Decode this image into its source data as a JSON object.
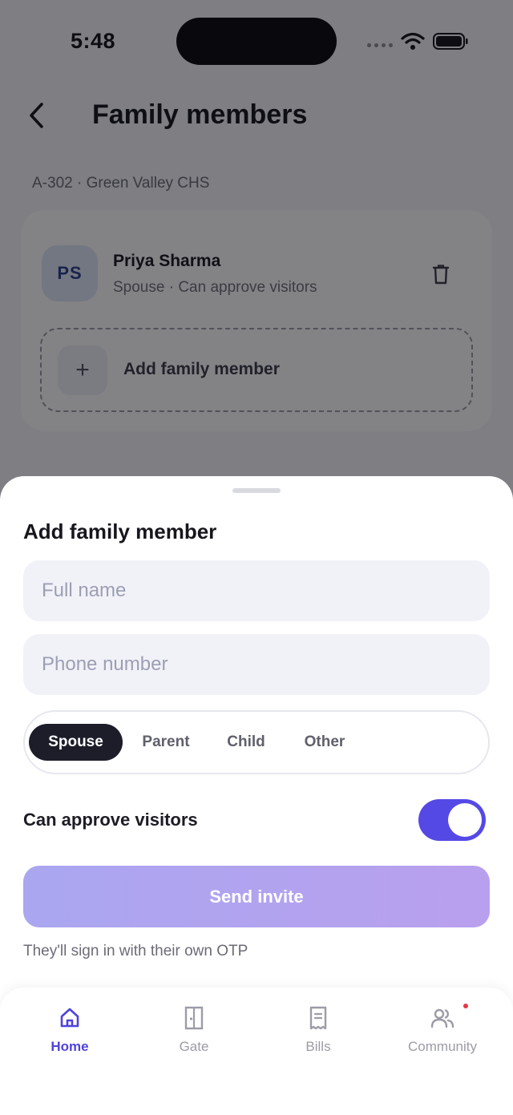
{
  "status_bar": {
    "time": "5:48"
  },
  "header": {
    "title": "Family members"
  },
  "unit": "A-302 · Green Valley CHS",
  "member": {
    "initials": "PS",
    "name": "Priya Sharma",
    "subtitle": "Spouse · Can approve visitors"
  },
  "add_member_label": "Add family member",
  "sheet": {
    "title": "Add family member",
    "name_placeholder": "Full name",
    "phone_placeholder": "Phone number",
    "relations": [
      "Spouse",
      "Parent",
      "Child",
      "Other"
    ],
    "selected_relation": "Spouse",
    "approve_label": "Can approve visitors",
    "approve_enabled": true,
    "send_label": "Send invite",
    "hint": "They'll sign in with their own OTP"
  },
  "tabs": [
    {
      "label": "Home",
      "icon": "home-icon",
      "active": true
    },
    {
      "label": "Gate",
      "icon": "door-icon",
      "active": false
    },
    {
      "label": "Bills",
      "icon": "receipt-icon",
      "active": false
    },
    {
      "label": "Community",
      "icon": "people-icon",
      "active": false,
      "badge": true
    }
  ],
  "colors": {
    "accent": "#5549e6",
    "active_chip": "#1c1d29",
    "field_bg": "#f1f2f8",
    "badge": "#e53945"
  }
}
